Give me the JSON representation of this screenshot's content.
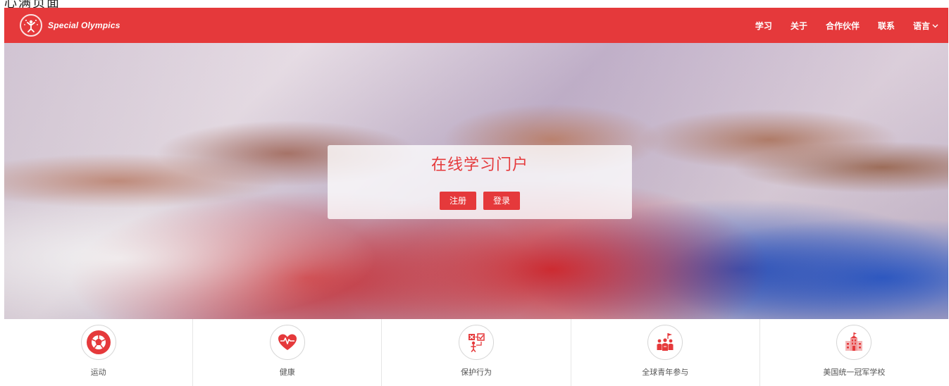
{
  "browser": {
    "tab_fragment": "心满页面"
  },
  "header": {
    "logo_text": "Special Olympics",
    "nav": [
      {
        "label": "学习"
      },
      {
        "label": "关于"
      },
      {
        "label": "合作伙伴"
      },
      {
        "label": "联系"
      },
      {
        "label": "语言",
        "has_dropdown": true
      }
    ]
  },
  "hero": {
    "title": "在线学习门户",
    "register_label": "注册",
    "login_label": "登录"
  },
  "categories": [
    {
      "label": "运动",
      "icon": "soccer-ball-icon"
    },
    {
      "label": "健康",
      "icon": "heart-health-icon"
    },
    {
      "label": "保护行为",
      "icon": "protective-behavior-icon"
    },
    {
      "label": "全球青年参与",
      "icon": "youth-group-icon"
    },
    {
      "label": "美国统一冠军学校",
      "icon": "school-icon"
    }
  ],
  "colors": {
    "brand_red": "#e5393b",
    "white": "#ffffff"
  }
}
